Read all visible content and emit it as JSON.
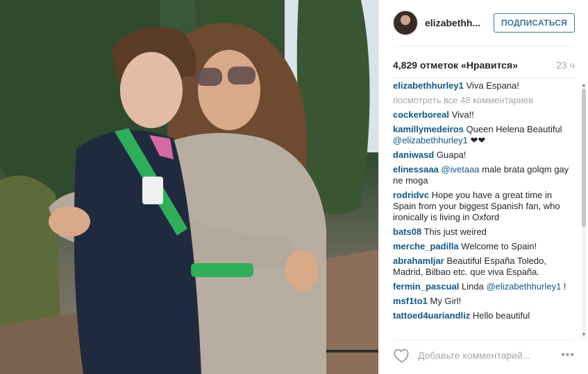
{
  "post": {
    "username": "elizabethh...",
    "follow_label": "ПОДПИСАТЬСЯ",
    "likes": "4,829 отметок «Нравится»",
    "time": "23 ч"
  },
  "comments_section": {
    "caption": {
      "author": "elizabethhurley1",
      "text": "Viva Espana!"
    },
    "view_all": "посмотреть все 48 комментариев",
    "items": [
      {
        "author": "cockerboreal",
        "text": "Viva!!"
      },
      {
        "author": "kamillymedeiros",
        "text": "Queen Helena Beautiful",
        "mention": "@elizabethhurley1",
        "after": " ❤❤"
      },
      {
        "author": "daniwasd",
        "text": "Guapa!"
      },
      {
        "author": "elinessaaa",
        "mention": "@ivetaaa",
        "after": " male brata golqm gay ne moga"
      },
      {
        "author": "rodridvc",
        "text": "Hope you have a great time in Spain from your biggest Spanish fan, who ironically is living in Oxford"
      },
      {
        "author": "bats08",
        "text": "This just weired"
      },
      {
        "author": "merche_padilla",
        "text": "Welcome to Spain!"
      },
      {
        "author": "abrahamljar",
        "text": "Beautiful España Toledo, Madrid, Bilbao etc. que viva España."
      },
      {
        "author": "fermin_pascual",
        "text": "Linda",
        "mention": "@elizabethhurley1",
        "after": " !"
      },
      {
        "author": "msf1to1",
        "text": "My Girl!"
      },
      {
        "author": "tattoed4uariandliz",
        "text": "Hello beautiful"
      }
    ]
  },
  "footer": {
    "comment_placeholder": "Добавьте комментарий...",
    "more": "•••"
  },
  "icons": {
    "like": "heart-outline-icon",
    "more": "more-options-icon",
    "scroll_up": "triangle-up",
    "scroll_down": "triangle-down"
  },
  "colors": {
    "username_link": "#125688",
    "follow_button": "#3f729b",
    "muted": "#a5a7aa"
  }
}
